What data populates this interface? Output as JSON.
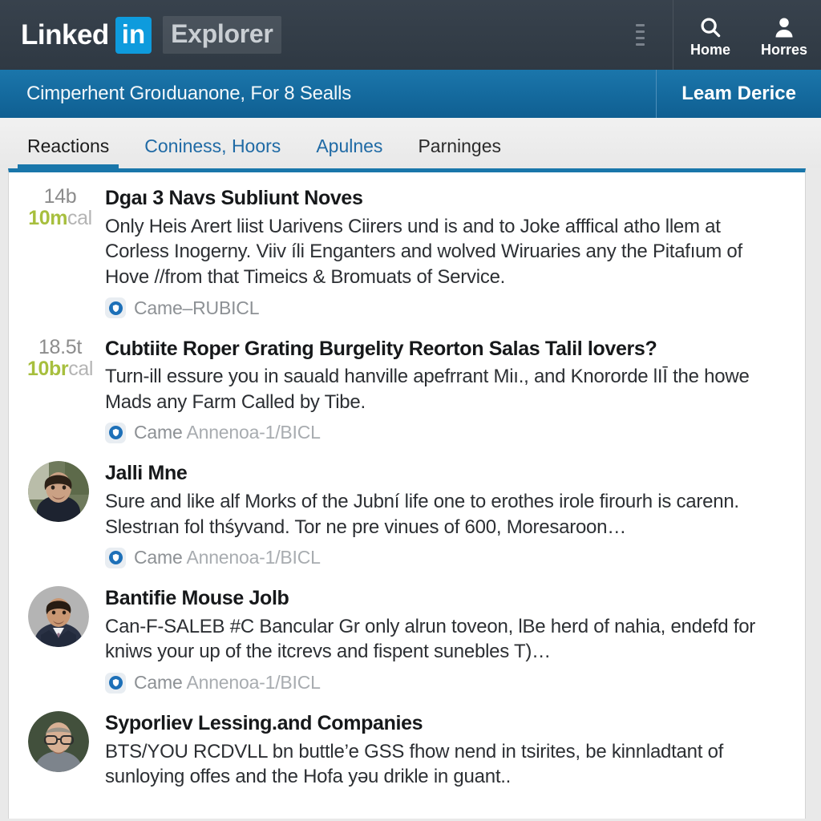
{
  "header": {
    "brand_primary": "Linked",
    "brand_badge": "in",
    "brand_secondary": "Explorer",
    "menu_icon": "vertical-dashes-icon",
    "nav": [
      {
        "icon": "search-icon",
        "label": "Home"
      },
      {
        "icon": "person-icon",
        "label": "Horres"
      }
    ]
  },
  "banner": {
    "message": "Cimperhent Groıduanone, For 8 Sealls",
    "action_label": "Leam Derice",
    "background_color": "#16699c"
  },
  "tabs": [
    {
      "label": "Reactions",
      "style": "active",
      "selected": true
    },
    {
      "label": "Coniness, Hoors",
      "style": "link",
      "selected": false
    },
    {
      "label": "Apulnes",
      "style": "link",
      "selected": false
    },
    {
      "label": "Parninges",
      "style": "dark",
      "selected": false
    }
  ],
  "accent_color": "#1976aa",
  "feed": [
    {
      "metric_top": "14b",
      "metric_value": "10m",
      "metric_unit": "cal",
      "has_avatar": false,
      "title": "Dgaı 3 Navs Subliunt Noves",
      "text": "Only Heis Arert liist Uarivens Ciirers und is and to Joke afffical atho llem at Corless Inogerny. Viiv íli Enganters and wolved Wiruaries any the Pitafıum of Hove //from that Timeics & Bromuats of Service.",
      "meta": "Came–RUBICL",
      "meta_icon": "shield-check-icon"
    },
    {
      "metric_top": "18.5t",
      "metric_value": "10br",
      "metric_unit": "cal",
      "has_avatar": false,
      "title": "Cubtiite Roper Grating Burgelity Reorton Salas Talil lovers?",
      "text": "Turn-ill essure you in sauald hanville apefrrant Miı., and Knororde lIĪ the howe Mads any Farm Called by Tibe.",
      "meta": "Came",
      "meta_suffix": "Annenoa-1/BICL",
      "meta_icon": "shield-check-icon"
    },
    {
      "metric_top": "",
      "metric_value": "",
      "metric_unit": "",
      "has_avatar": true,
      "avatar": "photo-man-dark-shirt",
      "title": "Jalli Mne",
      "text": "Sure and like alf Morks of the Jubní life one to erothes irole firourh is carenn. Slestrıan fol thśyvand. Tor ne pre vinues of 600, Moresaroon…",
      "meta": "Came",
      "meta_suffix": "Annenoa-1/BICL",
      "meta_icon": "shield-check-icon"
    },
    {
      "metric_top": "",
      "metric_value": "",
      "metric_unit": "",
      "has_avatar": true,
      "avatar": "photo-man-suit",
      "title": "Bantifie Mouse Jolb",
      "text": "Can-F-SALEB #C Bancular Gr only alrun toveon, lBe herd of nahia, endefd for kniws your up of the itcrevs and fispent sunebles T)…",
      "meta": "Came",
      "meta_suffix": "Annenoa-1/BICL",
      "meta_icon": "shield-check-icon"
    },
    {
      "metric_top": "",
      "metric_value": "",
      "metric_unit": "",
      "has_avatar": true,
      "avatar": "photo-man-glasses",
      "title": "Syporliev Lessing.and Companies",
      "text": "BTS/YOU RCDVLL bn buttle’e GSS fhow nend in tsirites, be kinnladtant of sunloying offes and the Hofa yəu drikle in guant..",
      "meta": "",
      "meta_suffix": "",
      "meta_icon": "shield-check-icon"
    }
  ]
}
